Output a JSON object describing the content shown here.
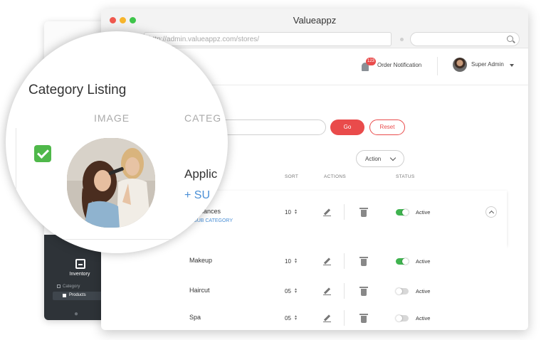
{
  "window": {
    "title": "Valueappz",
    "url": "http://admin.valueappz.com/stores/"
  },
  "header": {
    "notification_count": "123",
    "order_notification": "Order Notification",
    "user_name": "Super Admin"
  },
  "sidebar": {
    "section": "Inventory",
    "items": [
      {
        "label": "Category"
      },
      {
        "label": "Products"
      }
    ]
  },
  "toolbar": {
    "search_placeholder": "Search...",
    "go_label": "Go",
    "reset_label": "Reset",
    "action_label": "Action"
  },
  "table": {
    "columns": {
      "sort": "SORT",
      "actions": "ACTIONS",
      "status": "STATUS"
    },
    "add_sub_category": "+ SUB CATEGORY",
    "rows": [
      {
        "name": "Appliances",
        "sort": "10",
        "status": "Active",
        "enabled": true
      },
      {
        "name": "Makeup",
        "sort": "10",
        "status": "Active",
        "enabled": true
      },
      {
        "name": "Haircut",
        "sort": "05",
        "status": "Active",
        "enabled": false
      },
      {
        "name": "Spa",
        "sort": "05",
        "status": "Active",
        "enabled": false
      }
    ]
  },
  "magnifier": {
    "title": "Category Listing",
    "col_image": "IMAGE",
    "col_category": "CATEG",
    "category_name": "Applic",
    "sub_label": "+ SU"
  },
  "colors": {
    "accent_red": "#e94b4b",
    "toggle_on": "#3fb34f",
    "link_blue": "#4a8fd6",
    "sidebar_dark": "#2e3338"
  }
}
